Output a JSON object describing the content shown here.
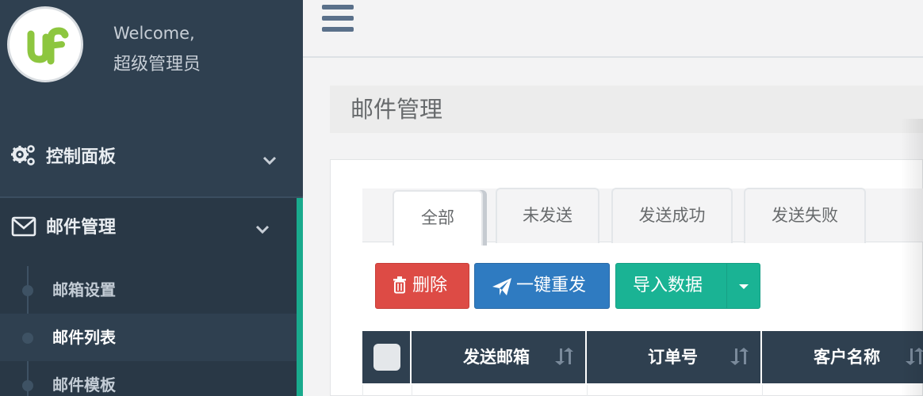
{
  "sidebar": {
    "welcome": "Welcome,",
    "user_name": "超级管理员",
    "menu": [
      {
        "label": "控制面板",
        "icon": "gears-icon"
      },
      {
        "label": "邮件管理",
        "icon": "envelope-icon"
      }
    ],
    "submenu": [
      {
        "label": "邮箱设置"
      },
      {
        "label": "邮件列表",
        "active": true
      },
      {
        "label": "邮件模板"
      }
    ]
  },
  "header": {
    "menu_toggle_icon": "hamburger-icon"
  },
  "page": {
    "title": "邮件管理"
  },
  "tabs": [
    {
      "label": "全部",
      "active": true
    },
    {
      "label": "未发送"
    },
    {
      "label": "发送成功"
    },
    {
      "label": "发送失败"
    }
  ],
  "toolbar": {
    "delete_label": "删除",
    "resend_label": "一键重发",
    "import_label": "导入数据"
  },
  "table": {
    "columns": [
      "发送邮箱",
      "订单号",
      "客户名称"
    ]
  },
  "colors": {
    "sidebar_bg": "#2f4050",
    "accent": "#19aa8d",
    "danger": "#dd4b45",
    "primary": "#2f7bc1",
    "success": "#1ab394"
  }
}
